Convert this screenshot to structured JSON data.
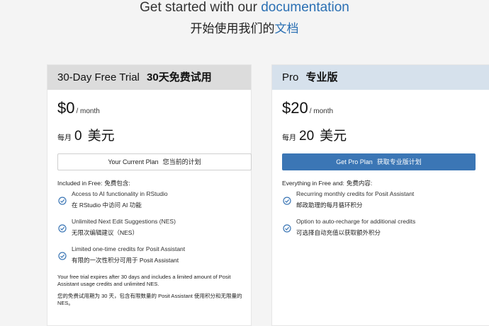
{
  "hero": {
    "en_prefix": "Get started with our ",
    "en_link": "documentation",
    "zh_prefix": "开始使用我们的",
    "zh_link": "文档"
  },
  "trial": {
    "title_en": "30-Day Free Trial",
    "title_zh": "30天免费试用",
    "price": "$0",
    "per": "/ month",
    "price_zh_prefix": "每月",
    "price_zh_amount": "0",
    "price_zh_unit": "美元",
    "button_en": "Your Current Plan",
    "button_zh": "您当前的计划",
    "included_en": "Included in Free:",
    "included_zh": "免费包含:",
    "features": [
      {
        "en": "Access to AI functionality in RStudio",
        "zh": "在 RStudio 中访问 AI 功能"
      },
      {
        "en": "Unlimited Next Edit Suggestions (NES)",
        "zh": "无限次编辑建议（NES）"
      },
      {
        "en": "Limited one-time credits for Posit Assistant",
        "zh": "有限的一次性积分可用于 Posit Assistant"
      }
    ],
    "fine_en": "Your free trial expires after 30 days and includes a limited amount of Posit Assistant usage credits and unlimited NES.",
    "fine_zh": "您的免费试用期为 30 天，包含有限数量的 Posit Assistant 使用积分和无限量的 NES。"
  },
  "pro": {
    "title_en": "Pro",
    "title_zh": "专业版",
    "price": "$20",
    "per": "/ month",
    "price_zh_prefix": "每月",
    "price_zh_amount": "20",
    "price_zh_unit": "美元",
    "button_en": "Get Pro Plan",
    "button_zh": "获取专业版计划",
    "included_en": "Everything in Free and:",
    "included_zh": "免费内容:",
    "features": [
      {
        "en": "Recurring monthly credits for Posit Assistant",
        "zh": "邮政助理的每月循环积分"
      },
      {
        "en": "Option to auto-recharge for additional credits",
        "zh": "可选择自动充值以获取额外积分"
      }
    ]
  },
  "colors": {
    "link": "#2a6fb3",
    "check": "#3b76b5",
    "primary_button": "#3b76b5"
  },
  "icons": {
    "feature_check": "check-circle-icon"
  }
}
